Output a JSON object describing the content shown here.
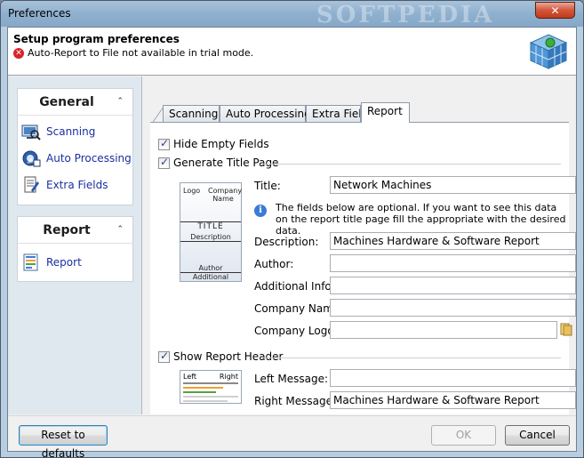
{
  "window": {
    "title": "Preferences",
    "watermark": "SOFTPEDIA",
    "close_glyph": "✕"
  },
  "header": {
    "title": "Setup program preferences",
    "warning": "Auto-Report to File not available in trial mode.",
    "warning_icon": "error-icon"
  },
  "sidebar": {
    "groups": [
      {
        "title": "General",
        "collapse_glyph": "⌃",
        "items": [
          {
            "label": "Scanning",
            "icon": "scanning-icon"
          },
          {
            "label": "Auto Processing",
            "icon": "auto-processing-icon"
          },
          {
            "label": "Extra Fields",
            "icon": "extra-fields-icon"
          }
        ]
      },
      {
        "title": "Report",
        "collapse_glyph": "⌃",
        "items": [
          {
            "label": "Report",
            "icon": "report-icon"
          }
        ]
      }
    ]
  },
  "tabs": [
    {
      "label": "Scanning",
      "active": false
    },
    {
      "label": "Auto Processing",
      "active": false
    },
    {
      "label": "Extra Field",
      "active": false
    },
    {
      "label": "Report",
      "active": true
    }
  ],
  "report": {
    "hide_empty_fields": {
      "label": "Hide Empty Fields",
      "checked": true
    },
    "generate_title_page": {
      "label": "Generate Title Page",
      "checked": true
    },
    "title_thumb": {
      "logo": "Logo",
      "company": "Company Name",
      "title": "TITLE",
      "description": "Description",
      "author": "Author",
      "additional": "Additional"
    },
    "title_label": "Title:",
    "title_value": "Network Machines",
    "info_text": "The fields below are optional. If you want to see this data on the report title page fill the appropriate with the desired data.",
    "description_label": "Description:",
    "description_value": "Machines Hardware & Software Report",
    "author_label": "Author:",
    "author_value": "",
    "additional_label": "Additional Info:",
    "additional_value": "",
    "company_label": "Company Name:",
    "company_value": "",
    "logo_label": "Company Logo:",
    "logo_value": "",
    "show_report_header": {
      "label": "Show Report Header",
      "checked": true
    },
    "header_thumb": {
      "left": "Left",
      "right": "Right"
    },
    "left_message_label": "Left Message:",
    "left_message_value": "",
    "right_message_label": "Right Message:",
    "right_message_value": "Machines Hardware & Software Report"
  },
  "footer": {
    "reset_label": "Reset to defaults",
    "ok_label": "OK",
    "ok_enabled": false,
    "cancel_label": "Cancel"
  },
  "colors": {
    "nav_link": "#1a2fa0",
    "error": "#d8242b",
    "info": "#3a7bd5"
  }
}
